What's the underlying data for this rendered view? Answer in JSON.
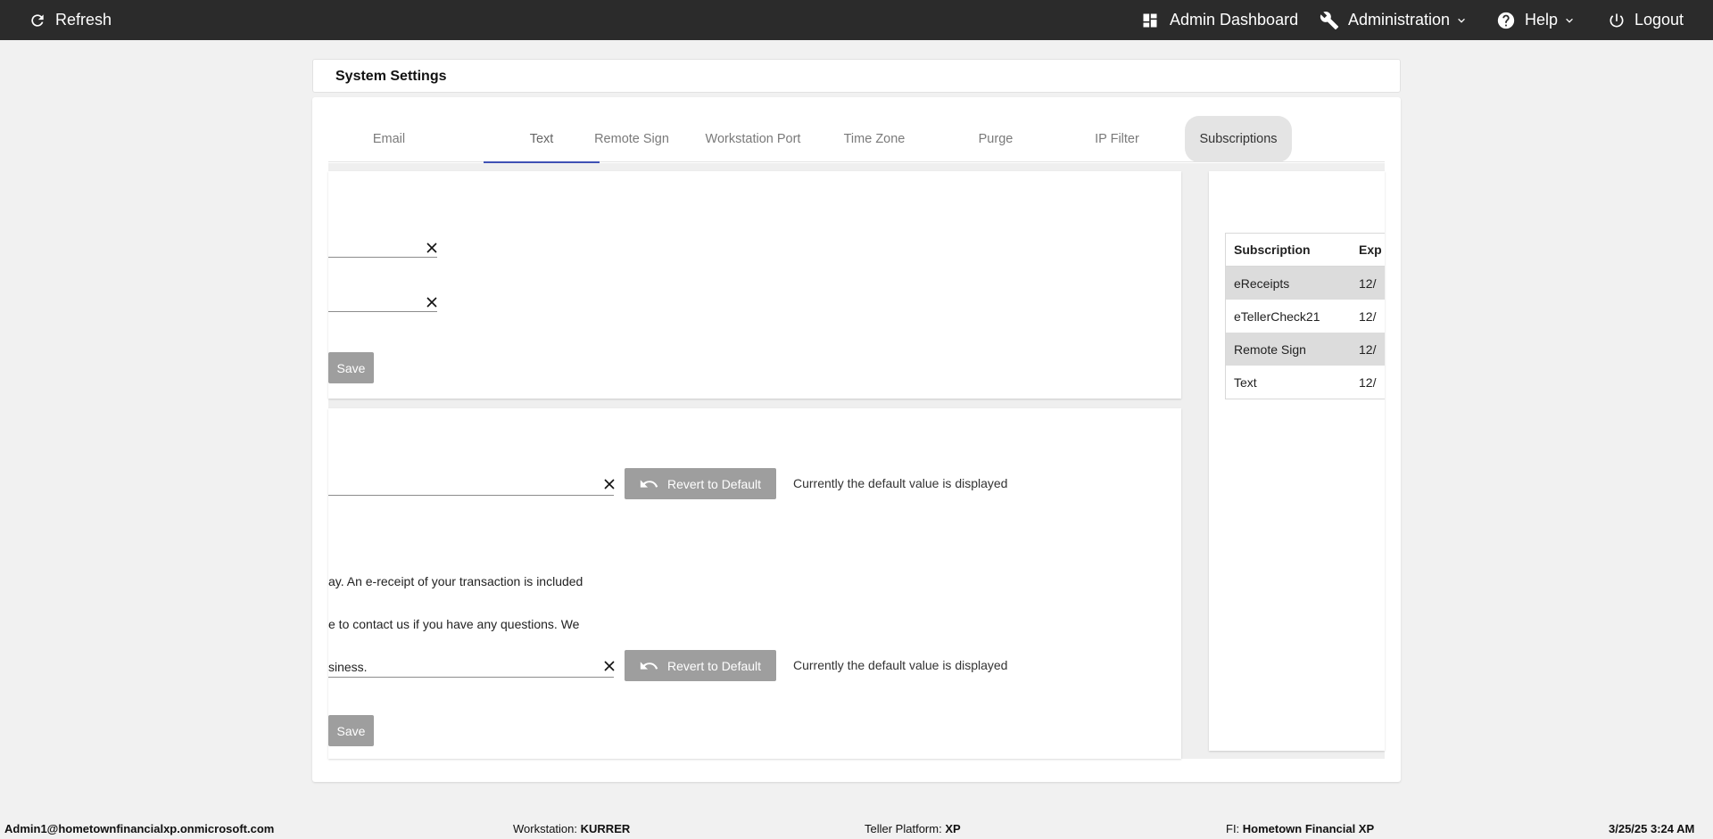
{
  "topbar": {
    "refresh_label": "Refresh",
    "admin_dashboard_label": "Admin Dashboard",
    "administration_label": "Administration",
    "help_label": "Help",
    "logout_label": "Logout"
  },
  "page": {
    "title": "System Settings"
  },
  "tabs": [
    {
      "label": "Email"
    },
    {
      "label": "Text"
    },
    {
      "label": "Remote Sign"
    },
    {
      "label": "Workstation Port"
    },
    {
      "label": "Time Zone"
    },
    {
      "label": "Purge"
    },
    {
      "label": "IP Filter"
    },
    {
      "label": "Subscriptions"
    }
  ],
  "active_tab": "Text",
  "panel1": {
    "field1_value": "",
    "field2_value": "",
    "save_label": "Save"
  },
  "panel2": {
    "field1_value": "",
    "revert_label": "Revert to Default",
    "status1": "Currently the default value is displayed",
    "message_line1": "ay. An e-receipt of your transaction is included",
    "message_line2": "e to contact us if you have any questions. We",
    "message_line3": "siness.",
    "field2_value": "",
    "revert2_label": "Revert to Default",
    "status2": "Currently the default value is displayed",
    "save_label": "Save"
  },
  "subscriptions": {
    "headers": [
      "Subscription",
      "Exp"
    ],
    "rows": [
      {
        "name": "eReceipts",
        "exp": "12/"
      },
      {
        "name": "eTellerCheck21",
        "exp": "12/"
      },
      {
        "name": "Remote Sign",
        "exp": "12/"
      },
      {
        "name": "Text",
        "exp": "12/"
      }
    ]
  },
  "footer": {
    "user": "Admin1@hometownfinancialxp.onmicrosoft.com",
    "workstation_label": "Workstation:",
    "workstation_value": "KURRER",
    "platform_label": "Teller Platform:",
    "platform_value": "XP",
    "fi_label": "FI:",
    "fi_value": "Hometown Financial XP",
    "datetime": "3/25/25 3:24 AM"
  }
}
